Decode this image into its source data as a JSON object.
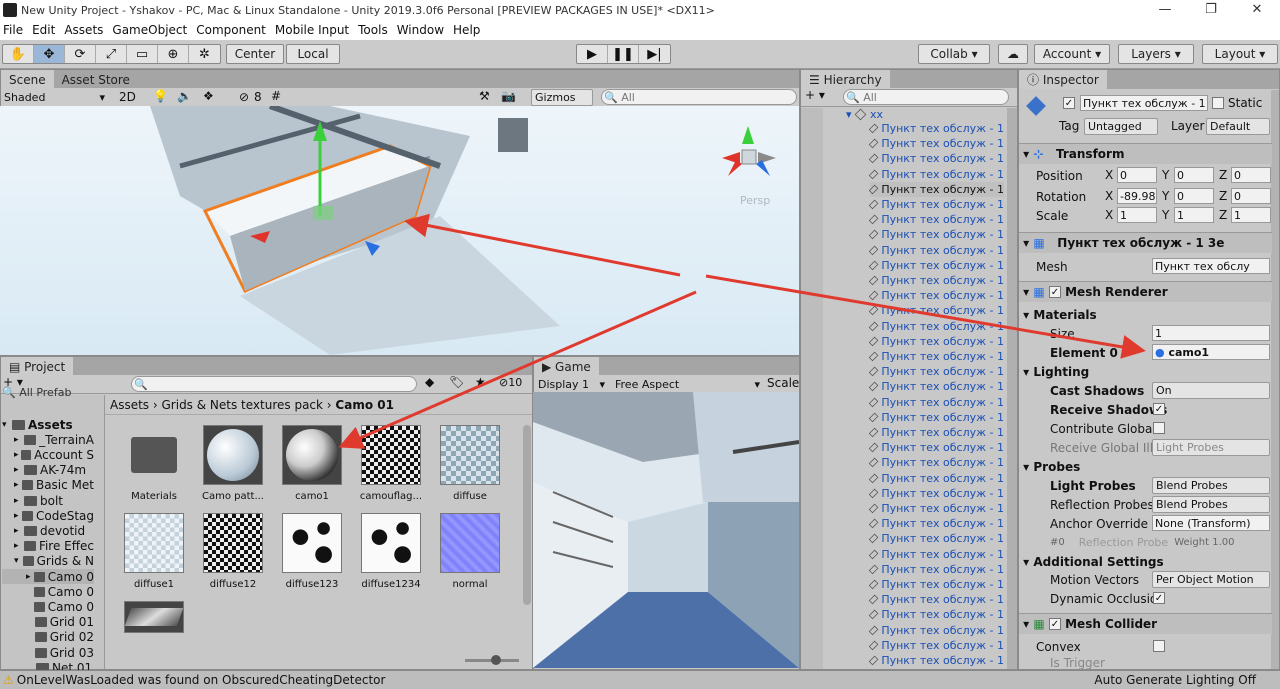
{
  "window": {
    "title": "New Unity Project - Yshakov - PC, Mac & Linux Standalone - Unity 2019.3.0f6 Personal [PREVIEW PACKAGES IN USE]* <DX11>",
    "min": "—",
    "max": "❐",
    "close": "✕"
  },
  "menu": [
    "File",
    "Edit",
    "Assets",
    "GameObject",
    "Component",
    "Mobile Input",
    "Tools",
    "Window",
    "Help"
  ],
  "toolbar": {
    "center": "Center",
    "local": "Local",
    "collab": "Collab",
    "account": "Account",
    "layers": "Layers",
    "layout": "Layout"
  },
  "scene": {
    "tabs": [
      "Scene",
      "Asset Store"
    ],
    "shading": "Shaded",
    "mode2d": "2D",
    "layer_count": "8",
    "gizmos": "Gizmos",
    "search_placeholder": "All",
    "persp": "Persp"
  },
  "hierarchy": {
    "tab": "Hierarchy",
    "search_placeholder": "All",
    "root": "xx",
    "item": "Пункт тех обслуж - 1",
    "selected_index": 4,
    "rows": 36
  },
  "project": {
    "tab": "Project",
    "breadcrumb": [
      "Assets",
      "Grids & Nets textures pack",
      "Camo 01"
    ],
    "count": "10",
    "favorite": "All Prefab",
    "tree": [
      "Assets",
      "_TerrainA",
      "Account S",
      "AK-74m",
      "Basic Met",
      "bolt",
      "CodeStag",
      "devotid",
      "Fire Effec",
      "Grids & N",
      "Camo 0",
      "Camo 0",
      "Camo 0",
      "Grid 01",
      "Grid 02",
      "Grid 03",
      "Net 01"
    ],
    "assets": [
      {
        "name": "Materials",
        "kind": "folder"
      },
      {
        "name": "Camo patt...",
        "kind": "sphere-camo"
      },
      {
        "name": "camo1",
        "kind": "sphere-dark"
      },
      {
        "name": "camouflag...",
        "kind": "tex-bw"
      },
      {
        "name": "diffuse",
        "kind": "tex-grey"
      },
      {
        "name": "diffuse1",
        "kind": "tex-light"
      },
      {
        "name": "diffuse12",
        "kind": "tex-bw"
      },
      {
        "name": "diffuse123",
        "kind": "tex-blob"
      },
      {
        "name": "diffuse1234",
        "kind": "tex-blob"
      },
      {
        "name": "normal",
        "kind": "tex-normal"
      },
      {
        "name": "",
        "kind": "plane"
      }
    ]
  },
  "game": {
    "tab": "Game",
    "display": "Display 1",
    "aspect": "Free Aspect",
    "scale": "Scale"
  },
  "inspector": {
    "tab": "Inspector",
    "object_name": "Пункт тех обслуж - 1",
    "static": "Static",
    "tag_label": "Tag",
    "tag": "Untagged",
    "layer_label": "Layer",
    "layer": "Default",
    "transform": {
      "title": "Transform",
      "position_label": "Position",
      "rotation_label": "Rotation",
      "scale_label": "Scale",
      "position": [
        "0",
        "0",
        "0"
      ],
      "rotation": [
        "-89.98",
        "0",
        "0"
      ],
      "scale": [
        "1",
        "1",
        "1"
      ]
    },
    "mesh_filter": {
      "title": "Пункт тех обслуж - 1 3e",
      "mesh_label": "Mesh",
      "mesh": "Пункт тех обслу"
    },
    "mesh_renderer": {
      "title": "Mesh Renderer",
      "materials": "Materials",
      "size_label": "Size",
      "size": "1",
      "element0_label": "Element 0",
      "element0": "camo1",
      "lighting": "Lighting",
      "cast_shadows_label": "Cast Shadows",
      "cast_shadows": "On",
      "receive_shadows": "Receive Shadows",
      "contribute_gi": "Contribute Global I",
      "receive_gi": "Receive Global Illu",
      "receive_gi_value": "Light Probes",
      "probes": "Probes",
      "light_probes_label": "Light Probes",
      "light_probes": "Blend Probes",
      "reflection_probes_label": "Reflection Probes",
      "reflection_probes": "Blend Probes",
      "anchor_label": "Anchor Override",
      "anchor": "None (Transform)",
      "probe_index": "#0",
      "probe_name": "Reflection Probe",
      "probe_weight": "Weight 1.00",
      "additional": "Additional Settings",
      "motion_label": "Motion Vectors",
      "motion": "Per Object Motion",
      "dynamic_occlusion": "Dynamic Occlusio"
    },
    "mesh_collider": {
      "title": "Mesh Collider",
      "convex": "Convex",
      "is_trigger": "Is Trigger"
    }
  },
  "status": {
    "message": "OnLevelWasLoaded was found on ObscuredCheatingDetector",
    "right": "Auto Generate Lighting Off"
  },
  "colors": {
    "accent": "#3a72c9",
    "arrow": "#e03a2f",
    "selection_outline": "#f07d1f"
  }
}
